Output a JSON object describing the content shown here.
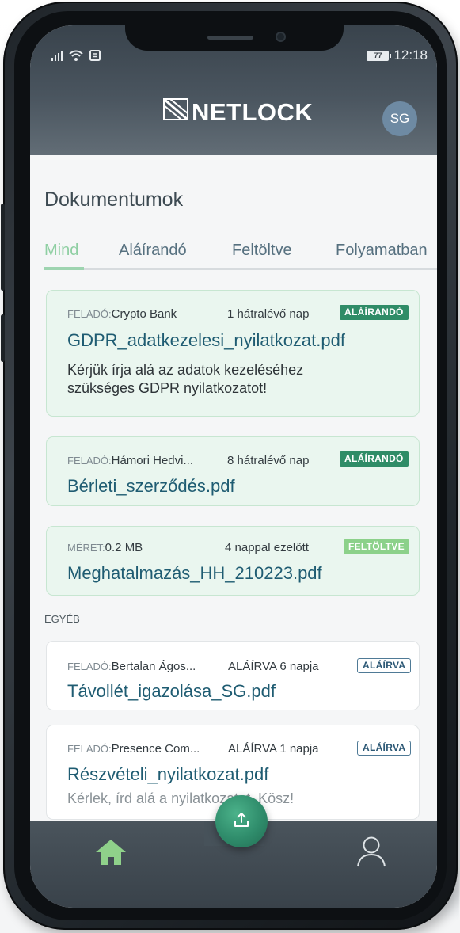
{
  "status_bar": {
    "time": "12:18",
    "battery": "77"
  },
  "header": {
    "logo_text": "NETLOCK",
    "avatar_initials": "SG"
  },
  "page_title": "Dokumentumok",
  "tabs": [
    {
      "label": "Mind",
      "active": true
    },
    {
      "label": "Aláírandó",
      "active": false
    },
    {
      "label": "Feltöltve",
      "active": false
    },
    {
      "label": "Folyamatban",
      "active": false
    }
  ],
  "documents": [
    {
      "meta_label": "FELADÓ:",
      "meta_value": "Crypto Bank",
      "time_info": "1 hátralévő nap",
      "badge": "ALÁÍRANDÓ",
      "file_name": "GDPR_adatkezelesi_nyilatkozat.pdf",
      "description_line1": "Kérjük írja alá az adatok kezeléséhez",
      "description_line2": "szükséges GDPR nyilatkozatot!"
    },
    {
      "meta_label": "FELADÓ:",
      "meta_value": "Hámori Hedvi...",
      "time_info": "8 hátralévő nap",
      "badge": "ALÁÍRANDÓ",
      "file_name": "Bérleti_szerződés.pdf"
    },
    {
      "meta_label": "MÉRET:",
      "meta_value": "0.2 MB",
      "time_info": "4 nappal ezelőtt",
      "badge": "FELTÖLTVE",
      "file_name": "Meghatalmazás_HH_210223.pdf"
    }
  ],
  "other_section_label": "EGYÉB",
  "other_documents": [
    {
      "meta_label": "FELADÓ:",
      "meta_value": "Bertalan Ágos...",
      "time_info": "ALÁÍRVA 6 napja",
      "badge": "ALÁÍRVA",
      "file_name": "Távollét_igazolása_SG.pdf"
    },
    {
      "meta_label": "FELADÓ:",
      "meta_value": "Presence Com...",
      "time_info": "ALÁÍRVA 1 napja",
      "badge": "ALÁÍRVA",
      "file_name": "Részvételi_nyilatkozat.pdf",
      "description": "Kérlek, írd alá a nyilatkozatot. Kösz!"
    }
  ],
  "colors": {
    "header": "#39434c",
    "accent_green": "#2f8c67",
    "card_bg": "#eaf6ef",
    "file_name": "#1f5c72",
    "tab_active": "#8fcfa3"
  },
  "icons": {
    "signal": "signal-icon",
    "wifi": "wifi-icon",
    "notification": "notification-icon",
    "upload": "upload-icon",
    "home": "home-icon",
    "user": "user-icon"
  }
}
